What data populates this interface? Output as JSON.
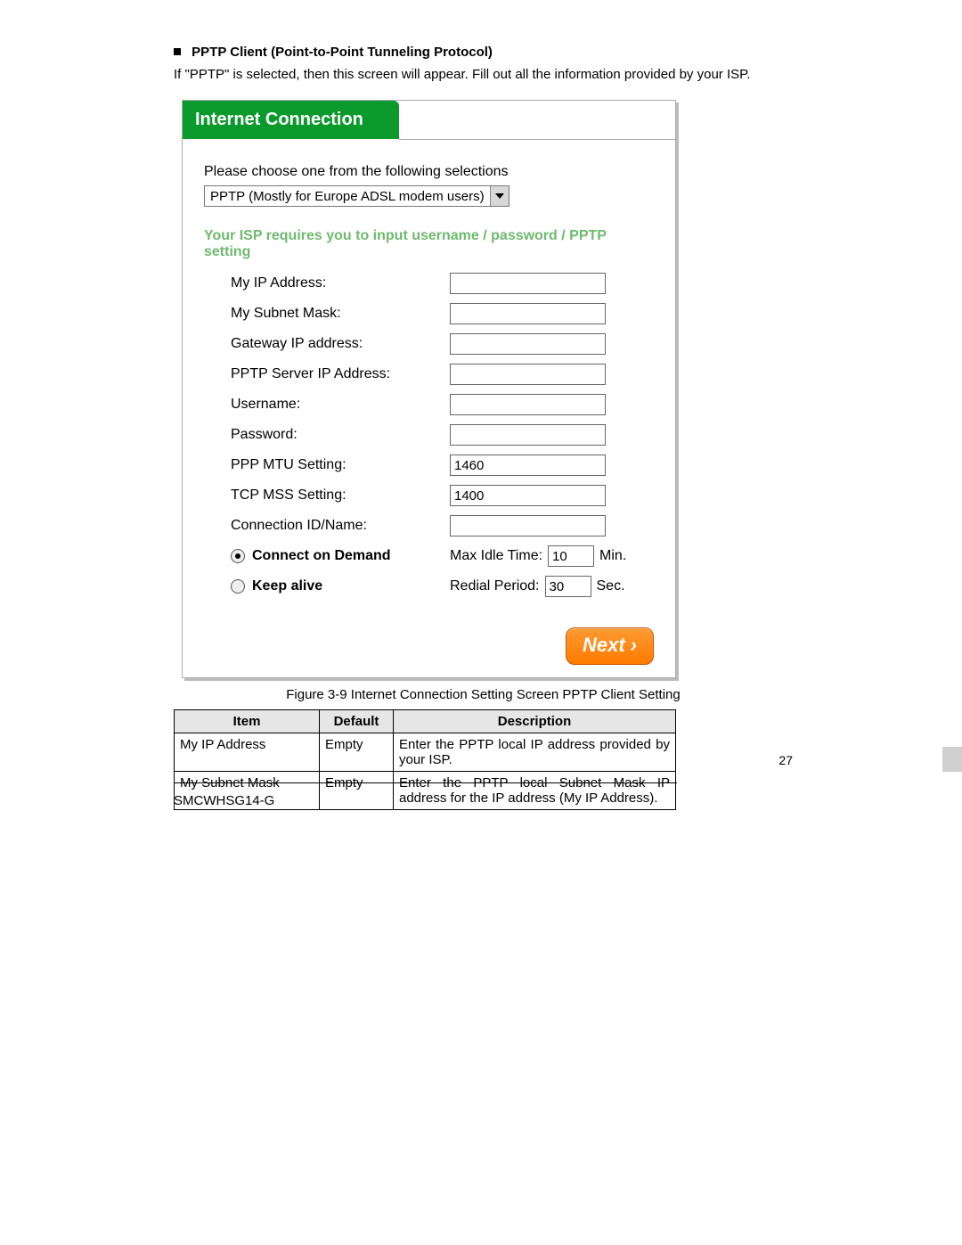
{
  "heading": "PPTP Client (Point-to-Point Tunneling Protocol)",
  "intro": "If \"PPTP\" is selected, then this screen will appear. Fill out all the information provided by your ISP.",
  "panel": {
    "title": "Internet Connection",
    "prompt": "Please choose one from the following selections",
    "select_value": "PPTP (Mostly for Europe ADSL modem users)",
    "note": "Your ISP requires you to input username / password / PPTP setting",
    "fields": {
      "my_ip": {
        "label": "My IP Address:",
        "value": ""
      },
      "subnet": {
        "label": "My Subnet Mask:",
        "value": ""
      },
      "gateway": {
        "label": "Gateway IP address:",
        "value": ""
      },
      "pptp_server": {
        "label": "PPTP Server IP Address:",
        "value": ""
      },
      "username": {
        "label": "Username:",
        "value": ""
      },
      "password": {
        "label": "Password:",
        "value": ""
      },
      "ppp_mtu": {
        "label": "PPP MTU Setting:",
        "value": "1460"
      },
      "tcp_mss": {
        "label": "TCP MSS Setting:",
        "value": "1400"
      },
      "conn_id": {
        "label": "Connection ID/Name:",
        "value": ""
      }
    },
    "radios": {
      "connect_on_demand": {
        "label": "Connect on Demand",
        "right_label": "Max Idle Time:",
        "value": "10",
        "unit": "Min."
      },
      "keep_alive": {
        "label": "Keep alive",
        "right_label": "Redial Period:",
        "value": "30",
        "unit": "Sec."
      }
    },
    "next": "Next"
  },
  "figure_caption": "Figure 3-9 Internet Connection Setting Screen PPTP Client Setting",
  "table": {
    "headers": [
      "Item",
      "Default",
      "Description"
    ],
    "rows": [
      [
        "My IP Address",
        "Empty",
        "Enter the PPTP local IP address provided by your ISP."
      ],
      [
        "My Subnet Mask",
        "Empty",
        "Enter the PPTP local Subnet Mask IP address for the IP address (My IP Address)."
      ]
    ]
  },
  "page_number": "27",
  "footer_id": "SMCWHSG14-G"
}
